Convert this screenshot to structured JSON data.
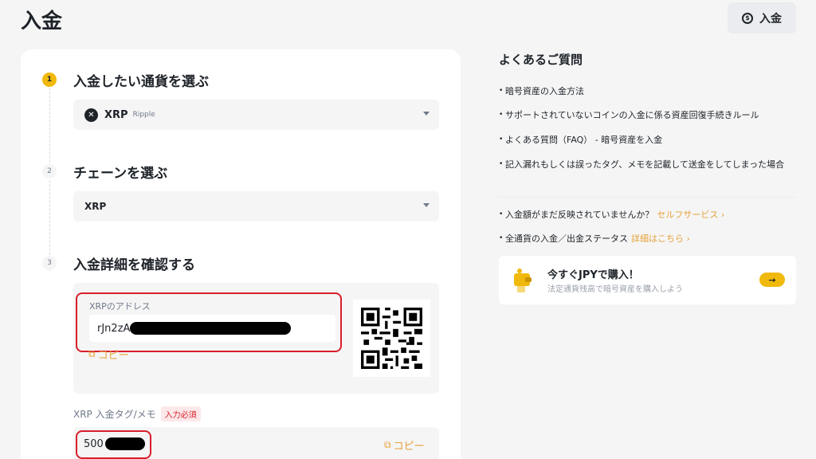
{
  "header": {
    "title": "入金",
    "deposit_button": "入金"
  },
  "steps": [
    {
      "number": "1",
      "title": "入金したい通貨を選ぶ"
    },
    {
      "number": "2",
      "title": "チェーンを選ぶ"
    },
    {
      "number": "3",
      "title": "入金詳細を確認する"
    }
  ],
  "coin_select": {
    "symbol": "XRP",
    "name": "Ripple"
  },
  "chain_select": {
    "value": "XRP"
  },
  "address": {
    "label": "XRPのアドレス",
    "value_prefix": "rJn2zA",
    "copy_label": "コピー"
  },
  "tag": {
    "label": "XRP 入金タグ/メモ",
    "required_badge": "入力必須",
    "value_prefix": "500",
    "copy_label": "コピー"
  },
  "faq": {
    "title": "よくあるご質問",
    "items": [
      "暗号資産の入金方法",
      "サポートされていないコインの入金に係る資産回復手続きルール",
      "よくある質問（FAQ） - 暗号資産を入金",
      "記入漏れもしくは誤ったタグ、メモを記載して送金をしてしまった場合"
    ],
    "extra": [
      {
        "text": "入金額がまだ反映されていませんか？",
        "link": "セルフサービス ›"
      },
      {
        "text": "全通貨の入金／出金ステータス",
        "link": "詳細はこちら ›"
      }
    ]
  },
  "promo": {
    "title": "今すぐJPYで購入！",
    "subtitle": "法定通貨残高で暗号資産を購入しよう"
  },
  "colors": {
    "accent": "#f0b90b",
    "link": "#e6a23c",
    "highlight": "#d91e2b"
  }
}
